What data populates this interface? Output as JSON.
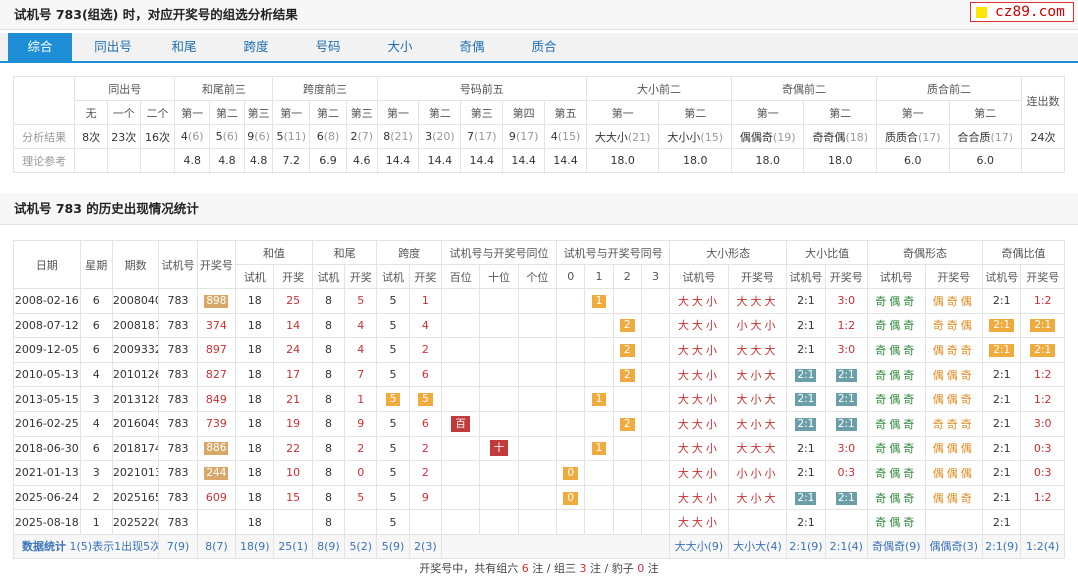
{
  "header": {
    "title": "试机号 783(组选) 时，对应开奖号的组选分析结果",
    "logo": "cz89.com"
  },
  "tabs": [
    "综合",
    "同出号",
    "和尾",
    "跨度",
    "号码",
    "大小",
    "奇偶",
    "质合"
  ],
  "analysis": {
    "groups": [
      "同出号",
      "和尾前三",
      "跨度前三",
      "号码前五",
      "大小前二",
      "奇偶前二",
      "质合前二",
      "连出数"
    ],
    "subs": [
      "无",
      "一个",
      "二个",
      "第一",
      "第二",
      "第三",
      "第一",
      "第二",
      "第三",
      "第一",
      "第二",
      "第三",
      "第四",
      "第五",
      "第一",
      "第二",
      "第一",
      "第二",
      "第一",
      "第二"
    ],
    "row_label": "分析结果",
    "result": [
      [
        "8次",
        ""
      ],
      [
        "23次",
        ""
      ],
      [
        "16次",
        ""
      ],
      [
        "4",
        "(6)"
      ],
      [
        "5",
        "(6)"
      ],
      [
        "9",
        "(6)"
      ],
      [
        "5",
        "(11)"
      ],
      [
        "6",
        "(8)"
      ],
      [
        "2",
        "(7)"
      ],
      [
        "8",
        "(21)"
      ],
      [
        "3",
        "(20)"
      ],
      [
        "7",
        "(17)"
      ],
      [
        "9",
        "(17)"
      ],
      [
        "4",
        "(15)"
      ],
      [
        "大大小",
        "(21)"
      ],
      [
        "大小小",
        "(15)"
      ],
      [
        "偶偶奇",
        "(19)"
      ],
      [
        "奇奇偶",
        "(18)"
      ],
      [
        "质质合",
        "(17)"
      ],
      [
        "合合质",
        "(17)"
      ],
      [
        "24次",
        ""
      ]
    ],
    "ref_label": "理论参考",
    "ref": [
      "",
      "",
      "",
      "4.8",
      "4.8",
      "4.8",
      "7.2",
      "6.9",
      "4.6",
      "14.4",
      "14.4",
      "14.4",
      "14.4",
      "14.4",
      "18.0",
      "18.0",
      "18.0",
      "18.0",
      "6.0",
      "6.0",
      ""
    ]
  },
  "history_title": "试机号 783 的历史出现情况统计",
  "history": {
    "col_date": "日期",
    "col_week": "星期",
    "col_issue": "期数",
    "col_test": "试机号",
    "col_draw": "开奖号",
    "groups": [
      "和值",
      "和尾",
      "跨度",
      "试机号与开奖号同位",
      "试机号与开奖号同号",
      "大小形态",
      "大小比值",
      "奇偶形态",
      "奇偶比值"
    ],
    "sub_tk": [
      "试机",
      "开奖"
    ],
    "sub_pos": [
      "百位",
      "十位",
      "个位"
    ],
    "sub_num": [
      "0",
      "1",
      "2",
      "3"
    ],
    "sub_form": [
      "试机号",
      "开奖号"
    ],
    "rows": [
      {
        "date": "2008-02-16",
        "week": "6",
        "issue": "2008040",
        "test": "783",
        "draw": "898",
        "draw_hl": 1,
        "sum_t": "18",
        "sum_d": "25",
        "tail_t": "8",
        "tail_d": "5",
        "span_t": "5",
        "span_d": "1",
        "pos": [
          "",
          "",
          ""
        ],
        "num": [
          "",
          "1",
          "",
          ""
        ],
        "dx_t": "大大小",
        "dx_d": "大大大",
        "dr_t": "2:1",
        "dr_d": "3:0",
        "dr_t_hl": 0,
        "dr_d_hl": 0,
        "jo_t": "奇偶奇",
        "jo_d": "偶奇偶",
        "jr_t": "2:1",
        "jr_d": "1:2",
        "jr_t_hl": 0,
        "jr_d_hl": 0
      },
      {
        "date": "2008-07-12",
        "week": "6",
        "issue": "2008187",
        "test": "783",
        "draw": "374",
        "draw_hl": 0,
        "sum_t": "18",
        "sum_d": "14",
        "tail_t": "8",
        "tail_d": "4",
        "span_t": "5",
        "span_d": "4",
        "pos": [
          "",
          "",
          ""
        ],
        "num": [
          "",
          "",
          "2",
          ""
        ],
        "dx_t": "大大小",
        "dx_d": "小大小",
        "dr_t": "2:1",
        "dr_d": "1:2",
        "dr_t_hl": 0,
        "dr_d_hl": 0,
        "jo_t": "奇偶奇",
        "jo_d": "奇奇偶",
        "jr_t": "2:1",
        "jr_d": "2:1",
        "jr_t_hl": 1,
        "jr_d_hl": 1
      },
      {
        "date": "2009-12-05",
        "week": "6",
        "issue": "2009332",
        "test": "783",
        "draw": "897",
        "draw_hl": 0,
        "sum_t": "18",
        "sum_d": "24",
        "tail_t": "8",
        "tail_d": "4",
        "span_t": "5",
        "span_d": "2",
        "pos": [
          "",
          "",
          ""
        ],
        "num": [
          "",
          "",
          "2",
          ""
        ],
        "dx_t": "大大小",
        "dx_d": "大大大",
        "dr_t": "2:1",
        "dr_d": "3:0",
        "dr_t_hl": 0,
        "dr_d_hl": 0,
        "jo_t": "奇偶奇",
        "jo_d": "偶奇奇",
        "jr_t": "2:1",
        "jr_d": "2:1",
        "jr_t_hl": 1,
        "jr_d_hl": 1
      },
      {
        "date": "2010-05-13",
        "week": "4",
        "issue": "2010126",
        "test": "783",
        "draw": "827",
        "draw_hl": 0,
        "sum_t": "18",
        "sum_d": "17",
        "tail_t": "8",
        "tail_d": "7",
        "span_t": "5",
        "span_d": "6",
        "pos": [
          "",
          "",
          ""
        ],
        "num": [
          "",
          "",
          "2",
          ""
        ],
        "dx_t": "大大小",
        "dx_d": "大小大",
        "dr_t": "2:1",
        "dr_d": "2:1",
        "dr_t_hl": 1,
        "dr_d_hl": 1,
        "jo_t": "奇偶奇",
        "jo_d": "偶偶奇",
        "jr_t": "2:1",
        "jr_d": "1:2",
        "jr_t_hl": 0,
        "jr_d_hl": 0
      },
      {
        "date": "2013-05-15",
        "week": "3",
        "issue": "2013128",
        "test": "783",
        "draw": "849",
        "draw_hl": 0,
        "sum_t": "18",
        "sum_d": "21",
        "tail_t": "8",
        "tail_d": "1",
        "span_t": "5",
        "span_d": "5",
        "span_hl": 1,
        "pos": [
          "",
          "",
          ""
        ],
        "num": [
          "",
          "1",
          "",
          ""
        ],
        "dx_t": "大大小",
        "dx_d": "大小大",
        "dr_t": "2:1",
        "dr_d": "2:1",
        "dr_t_hl": 1,
        "dr_d_hl": 1,
        "jo_t": "奇偶奇",
        "jo_d": "偶偶奇",
        "jr_t": "2:1",
        "jr_d": "1:2",
        "jr_t_hl": 0,
        "jr_d_hl": 0
      },
      {
        "date": "2016-02-25",
        "week": "4",
        "issue": "2016049",
        "test": "783",
        "draw": "739",
        "draw_hl": 0,
        "sum_t": "18",
        "sum_d": "19",
        "tail_t": "8",
        "tail_d": "9",
        "span_t": "5",
        "span_d": "6",
        "pos": [
          "百",
          "",
          ""
        ],
        "num": [
          "",
          "",
          "2",
          ""
        ],
        "dx_t": "大大小",
        "dx_d": "大小大",
        "dr_t": "2:1",
        "dr_d": "2:1",
        "dr_t_hl": 1,
        "dr_d_hl": 1,
        "jo_t": "奇偶奇",
        "jo_d": "奇奇奇",
        "jr_t": "2:1",
        "jr_d": "3:0",
        "jr_t_hl": 0,
        "jr_d_hl": 0
      },
      {
        "date": "2018-06-30",
        "week": "6",
        "issue": "2018174",
        "test": "783",
        "draw": "886",
        "draw_hl": 1,
        "sum_t": "18",
        "sum_d": "22",
        "tail_t": "8",
        "tail_d": "2",
        "span_t": "5",
        "span_d": "2",
        "pos": [
          "",
          "十",
          ""
        ],
        "num": [
          "",
          "1",
          "",
          ""
        ],
        "dx_t": "大大小",
        "dx_d": "大大大",
        "dr_t": "2:1",
        "dr_d": "3:0",
        "dr_t_hl": 0,
        "dr_d_hl": 0,
        "jo_t": "奇偶奇",
        "jo_d": "偶偶偶",
        "jr_t": "2:1",
        "jr_d": "0:3",
        "jr_t_hl": 0,
        "jr_d_hl": 0
      },
      {
        "date": "2021-01-13",
        "week": "3",
        "issue": "2021013",
        "test": "783",
        "draw": "244",
        "draw_hl": 1,
        "sum_t": "18",
        "sum_d": "10",
        "tail_t": "8",
        "tail_d": "0",
        "span_t": "5",
        "span_d": "2",
        "pos": [
          "",
          "",
          ""
        ],
        "num": [
          "0",
          "",
          "",
          ""
        ],
        "dx_t": "大大小",
        "dx_d": "小小小",
        "dr_t": "2:1",
        "dr_d": "0:3",
        "dr_t_hl": 0,
        "dr_d_hl": 0,
        "jo_t": "奇偶奇",
        "jo_d": "偶偶偶",
        "jr_t": "2:1",
        "jr_d": "0:3",
        "jr_t_hl": 0,
        "jr_d_hl": 0
      },
      {
        "date": "2025-06-24",
        "week": "2",
        "issue": "2025165",
        "test": "783",
        "draw": "609",
        "draw_hl": 0,
        "sum_t": "18",
        "sum_d": "15",
        "tail_t": "8",
        "tail_d": "5",
        "span_t": "5",
        "span_d": "9",
        "pos": [
          "",
          "",
          ""
        ],
        "num": [
          "0",
          "",
          "",
          ""
        ],
        "dx_t": "大大小",
        "dx_d": "大小大",
        "dr_t": "2:1",
        "dr_d": "2:1",
        "dr_t_hl": 1,
        "dr_d_hl": 1,
        "jo_t": "奇偶奇",
        "jo_d": "偶偶奇",
        "jr_t": "2:1",
        "jr_d": "1:2",
        "jr_t_hl": 0,
        "jr_d_hl": 0
      },
      {
        "date": "2025-08-18",
        "week": "1",
        "issue": "2025220",
        "test": "783",
        "draw": "",
        "draw_hl": 0,
        "sum_t": "18",
        "sum_d": "",
        "tail_t": "8",
        "tail_d": "",
        "span_t": "5",
        "span_d": "",
        "pos": [
          "",
          "",
          ""
        ],
        "num": [
          "",
          "",
          "",
          ""
        ],
        "dx_t": "大大小",
        "dx_d": "",
        "dr_t": "2:1",
        "dr_d": "",
        "dr_t_hl": 0,
        "dr_d_hl": 0,
        "jo_t": "奇偶奇",
        "jo_d": "",
        "jr_t": "2:1",
        "jr_d": "",
        "jr_t_hl": 0,
        "jr_d_hl": 0
      }
    ],
    "stats": {
      "label": "数据统计",
      "note": "1(5)表示1出现5次",
      "test": "7(9)",
      "draw": "8(7)",
      "sum_t": "18(9)",
      "sum_d": "25(1)",
      "tail_t": "8(9)",
      "tail_d": "5(2)",
      "span_t": "5(9)",
      "span_d": "2(3)",
      "dx_t": "大大小(9)",
      "dx_d": "大小大(4)",
      "dr_t": "2:1(9)",
      "dr_d": "2:1(4)",
      "jo_t": "奇偶奇(9)",
      "jo_d": "偶偶奇(3)",
      "jr_t": "2:1(9)",
      "jr_d": "1:2(4)"
    }
  },
  "footer": {
    "prefix": "开奖号中，共有组六 ",
    "n6": "6",
    "mid1": " 注 / 组三 ",
    "n3": "3",
    "mid2": " 注 / 豹子 ",
    "n0": "0",
    "suffix": " 注"
  },
  "colors": {
    "accent": "#1e8fd6",
    "red": "#c83232",
    "tan": "#d9a868",
    "orange": "#f0ab3f",
    "crimson": "#c23b3b",
    "teal": "#6a9ea8",
    "green": "#2f8b3a",
    "orange_text": "#e08a1e"
  }
}
